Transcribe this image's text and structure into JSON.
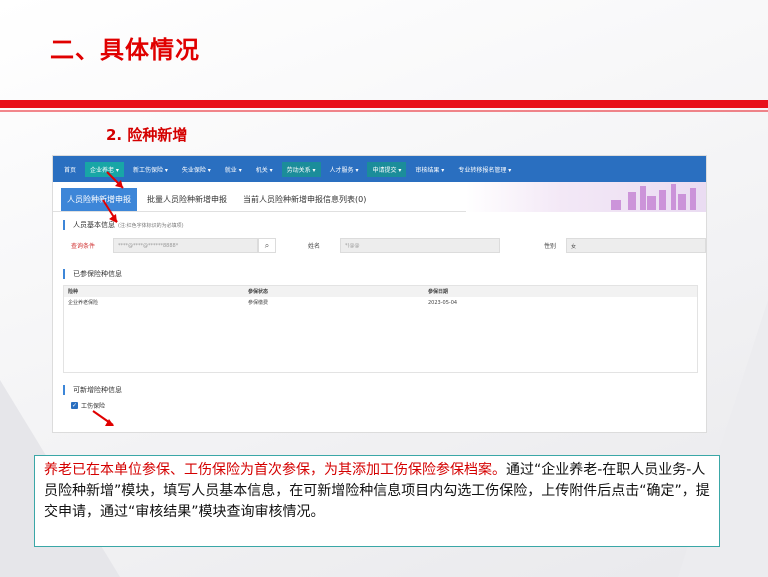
{
  "slide": {
    "title": "二、具体情况",
    "section": "2. 险种新增"
  },
  "screenshot": {
    "nav": [
      "首页",
      "企业养老 ▾",
      "新工伤保险 ▾",
      "失业保险 ▾",
      "就业 ▾",
      "机关 ▾",
      "劳动关系 ▾",
      "人才服务 ▾",
      "申请提交 ▾",
      "审核结果 ▾",
      "专业转移报名管理 ▾"
    ],
    "tabs": [
      "人员险种新增申报",
      "批量人员险种新增申报",
      "当前人员险种新增申报信息列表(0)"
    ],
    "basic_info": {
      "heading": "人员基本信息",
      "note": "(注:红色字体标识的为必填项)",
      "query_label": "查询条件",
      "query_value": "****@****@******8888*",
      "name_label": "姓名",
      "name_value": "*(@@",
      "gender_label": "性别",
      "gender_value": "女"
    },
    "insured": {
      "heading": "已参保险种信息",
      "columns": [
        "险种",
        "参保状态",
        "参保日期"
      ],
      "rows": [
        [
          "企业养老保险",
          "参保缴费",
          "2023-05-04"
        ]
      ]
    },
    "new_insurance": {
      "heading": "可新增险种信息",
      "option": "工伤保险"
    }
  },
  "description": {
    "red_part": "养老已在本单位参保、工伤保险为首次参保，为其添加工伤保险参保档案。",
    "black_part": "通过“企业养老-在职人员业务-人员险种新增”模块，填写人员基本信息，在可新增险种信息项目内勾选工伤保险，上传附件后点击“确定”，提交申请，通过“审核结果”模块查询审核情况。"
  },
  "colors": {
    "accent_red": "#e8101a",
    "nav_blue": "#2a6fc0",
    "frame_teal": "#3aa7a7"
  }
}
